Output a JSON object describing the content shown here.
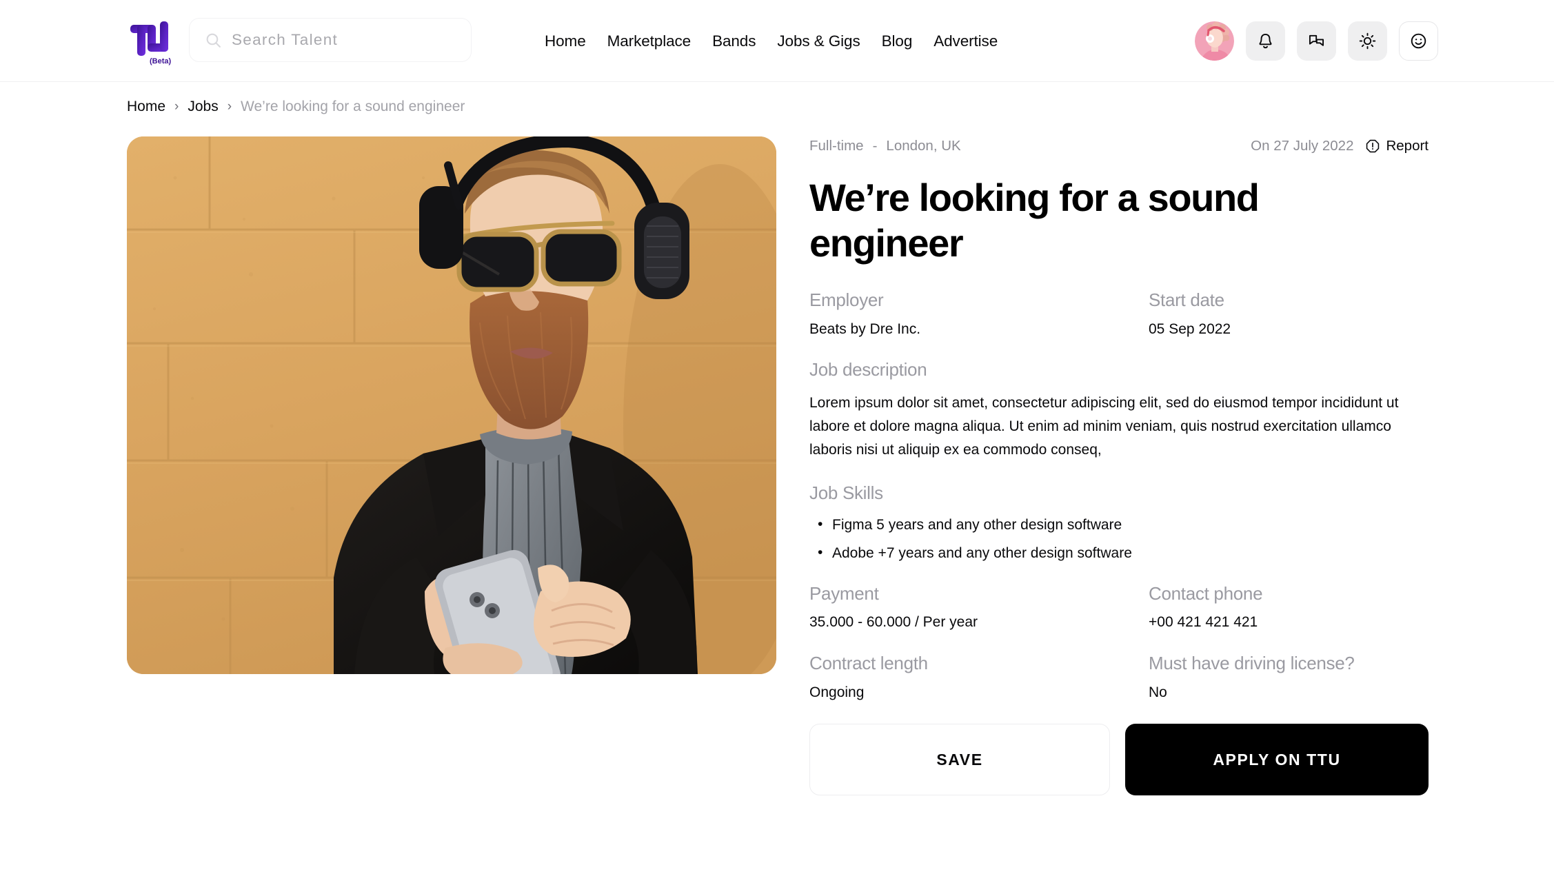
{
  "header": {
    "logo": {
      "text": "TU",
      "sublabel": "(Beta)",
      "color": "#5b23c4"
    },
    "search": {
      "placeholder": "Search Talent",
      "value": "",
      "icon": "search-icon"
    },
    "nav": [
      {
        "label": "Home"
      },
      {
        "label": "Marketplace"
      },
      {
        "label": "Bands"
      },
      {
        "label": "Jobs & Gigs"
      },
      {
        "label": "Blog"
      },
      {
        "label": "Advertise"
      }
    ],
    "actions": [
      {
        "name": "avatar",
        "icon": "user-avatar"
      },
      {
        "name": "notifications",
        "icon": "bell-icon"
      },
      {
        "name": "messages",
        "icon": "chat-bubbles-icon"
      },
      {
        "name": "theme-toggle",
        "icon": "sun-icon"
      },
      {
        "name": "profile-mood",
        "icon": "smiley-icon"
      }
    ]
  },
  "breadcrumb": {
    "items": [
      {
        "label": "Home",
        "current": false
      },
      {
        "label": "Jobs",
        "current": false
      },
      {
        "label": "We’re looking for a sound engineer",
        "current": true
      }
    ],
    "separator": "›"
  },
  "job": {
    "hero_alt": "Bearded man with headphones and sunglasses using a phone against a tan wall",
    "employment_type": "Full-time",
    "meta_separator": "-",
    "location": "London, UK",
    "posted": "On 27 July 2022",
    "report_label": "Report",
    "title": "We’re looking for a sound engineer",
    "employer_label": "Employer",
    "employer_value": "Beats by Dre Inc.",
    "start_date_label": "Start date",
    "start_date_value": "05 Sep 2022",
    "description_label": "Job description",
    "description_text": "Lorem ipsum dolor sit amet, consectetur adipiscing elit, sed do eiusmod tempor incididunt ut labore et dolore magna aliqua. Ut enim ad minim veniam, quis nostrud exercitation ullamco laboris nisi ut aliquip ex ea commodo conseq,",
    "skills_label": "Job Skills",
    "skills": [
      "Figma 5 years and any other design software",
      "Adobe +7 years and any other design software"
    ],
    "payment_label": "Payment",
    "payment_value": "35.000 - 60.000 / Per year",
    "contact_phone_label": "Contact phone",
    "contact_phone_value": "+00 421 421 421",
    "contract_length_label": "Contract length",
    "contract_length_value": "Ongoing",
    "driving_license_label": "Must have driving license?",
    "driving_license_value": "No",
    "save_button": "SAVE",
    "apply_button": "APPLY ON TTU"
  }
}
